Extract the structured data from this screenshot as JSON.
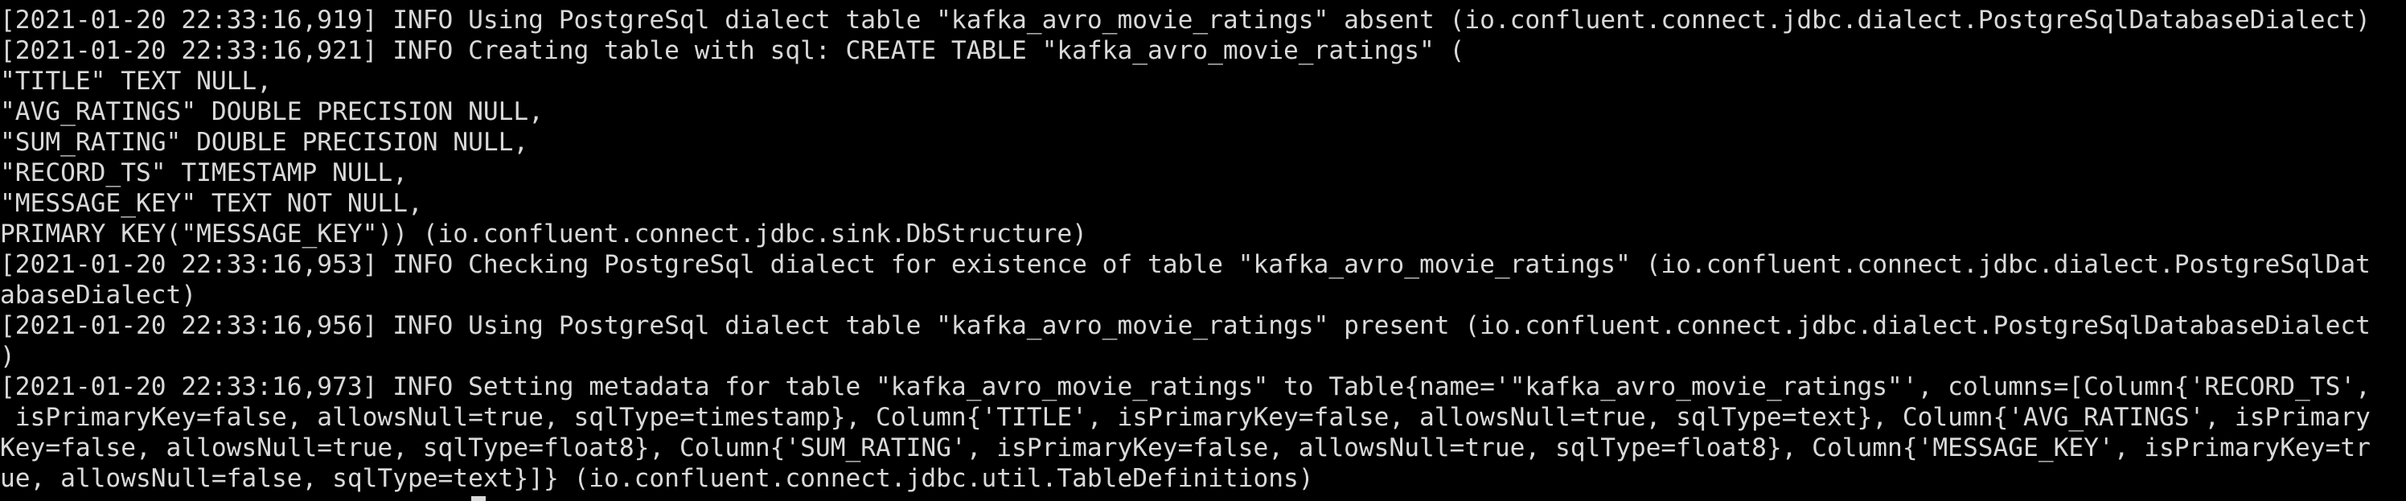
{
  "terminal": {
    "lines": [
      "[2021-01-20 22:33:16,919] INFO Using PostgreSql dialect table \"kafka_avro_movie_ratings\" absent (io.confluent.connect.jdbc.dialect.PostgreSqlDatabaseDialect)",
      "[2021-01-20 22:33:16,921] INFO Creating table with sql: CREATE TABLE \"kafka_avro_movie_ratings\" (",
      "\"TITLE\" TEXT NULL,",
      "\"AVG_RATINGS\" DOUBLE PRECISION NULL,",
      "\"SUM_RATING\" DOUBLE PRECISION NULL,",
      "\"RECORD_TS\" TIMESTAMP NULL,",
      "\"MESSAGE_KEY\" TEXT NOT NULL,",
      "PRIMARY KEY(\"MESSAGE_KEY\")) (io.confluent.connect.jdbc.sink.DbStructure)",
      "[2021-01-20 22:33:16,953] INFO Checking PostgreSql dialect for existence of table \"kafka_avro_movie_ratings\" (io.confluent.connect.jdbc.dialect.PostgreSqlDat",
      "abaseDialect)",
      "[2021-01-20 22:33:16,956] INFO Using PostgreSql dialect table \"kafka_avro_movie_ratings\" present (io.confluent.connect.jdbc.dialect.PostgreSqlDatabaseDialect",
      ")",
      "[2021-01-20 22:33:16,973] INFO Setting metadata for table \"kafka_avro_movie_ratings\" to Table{name='\"kafka_avro_movie_ratings\"', columns=[Column{'RECORD_TS',",
      " isPrimaryKey=false, allowsNull=true, sqlType=timestamp}, Column{'TITLE', isPrimaryKey=false, allowsNull=true, sqlType=text}, Column{'AVG_RATINGS', isPrimary",
      "Key=false, allowsNull=true, sqlType=float8}, Column{'SUM_RATING', isPrimaryKey=false, allowsNull=true, sqlType=float8}, Column{'MESSAGE_KEY', isPrimaryKey=tr",
      "ue, allowsNull=false, sqlType=text}]} (io.confluent.connect.jdbc.util.TableDefinitions)"
    ],
    "prompt_partial": "",
    "colors": {
      "background": "#000000",
      "foreground": "#d9d9d9"
    }
  }
}
